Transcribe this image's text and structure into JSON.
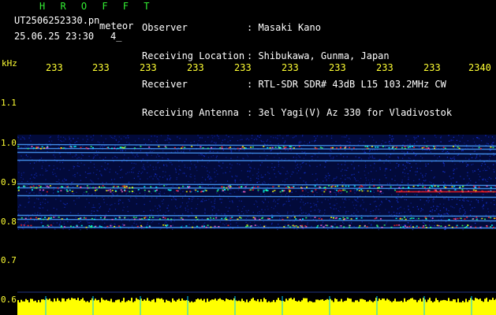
{
  "header": {
    "brand": "H R O F F T",
    "file_name": "UT2506252330.pn",
    "mode_label": "meteor",
    "date_time": "25.06.25 23:30",
    "counter": "4_",
    "info": [
      {
        "label": "Observer",
        "value": ": Masaki Kano"
      },
      {
        "label": "Receiving Location",
        "value": ": Shibukawa, Gunma, Japan"
      },
      {
        "label": "Receiver",
        "value": ": RTL-SDR SDR# 43dB L15 103.2MHz CW"
      },
      {
        "label": "Receiving Antenna",
        "value": ": 3el Yagi(V) Az 330 for Vladivostok"
      }
    ]
  },
  "axis": {
    "unit_label": "kHz",
    "time_ticks": [
      "233",
      "233",
      "233",
      "233",
      "233",
      "233",
      "233",
      "233",
      "233",
      "2340"
    ],
    "freq_ticks": [
      "1.1",
      "1.0",
      "0.9",
      "0.8",
      "0.7",
      "0.6"
    ]
  },
  "colors": {
    "background": "#000000",
    "label_yellow": "#ffff33",
    "brand_green": "#33ee33",
    "header_white": "#ffffff",
    "noise_blue": "#1a3cff",
    "signal_red": "#ff2020",
    "level_yellow": "#ffff00",
    "grid_blue": "#4aa0ff"
  },
  "chart_data": {
    "type": "heatmap",
    "x_axis_ticks": [
      "233",
      "233",
      "233",
      "233",
      "233",
      "233",
      "233",
      "233",
      "233",
      "2340"
    ],
    "y_axis_ticks": [
      1.1,
      1.0,
      0.9,
      0.8,
      0.7,
      0.6
    ],
    "ylabel": "kHz",
    "ylim": [
      0.6,
      1.15
    ],
    "noise_band_khz": [
      0.78,
      1.02
    ],
    "carrier_lines_khz": [
      0.995,
      0.985,
      0.975,
      0.955,
      0.895,
      0.885,
      0.865,
      0.815,
      0.805,
      0.785
    ]
  }
}
